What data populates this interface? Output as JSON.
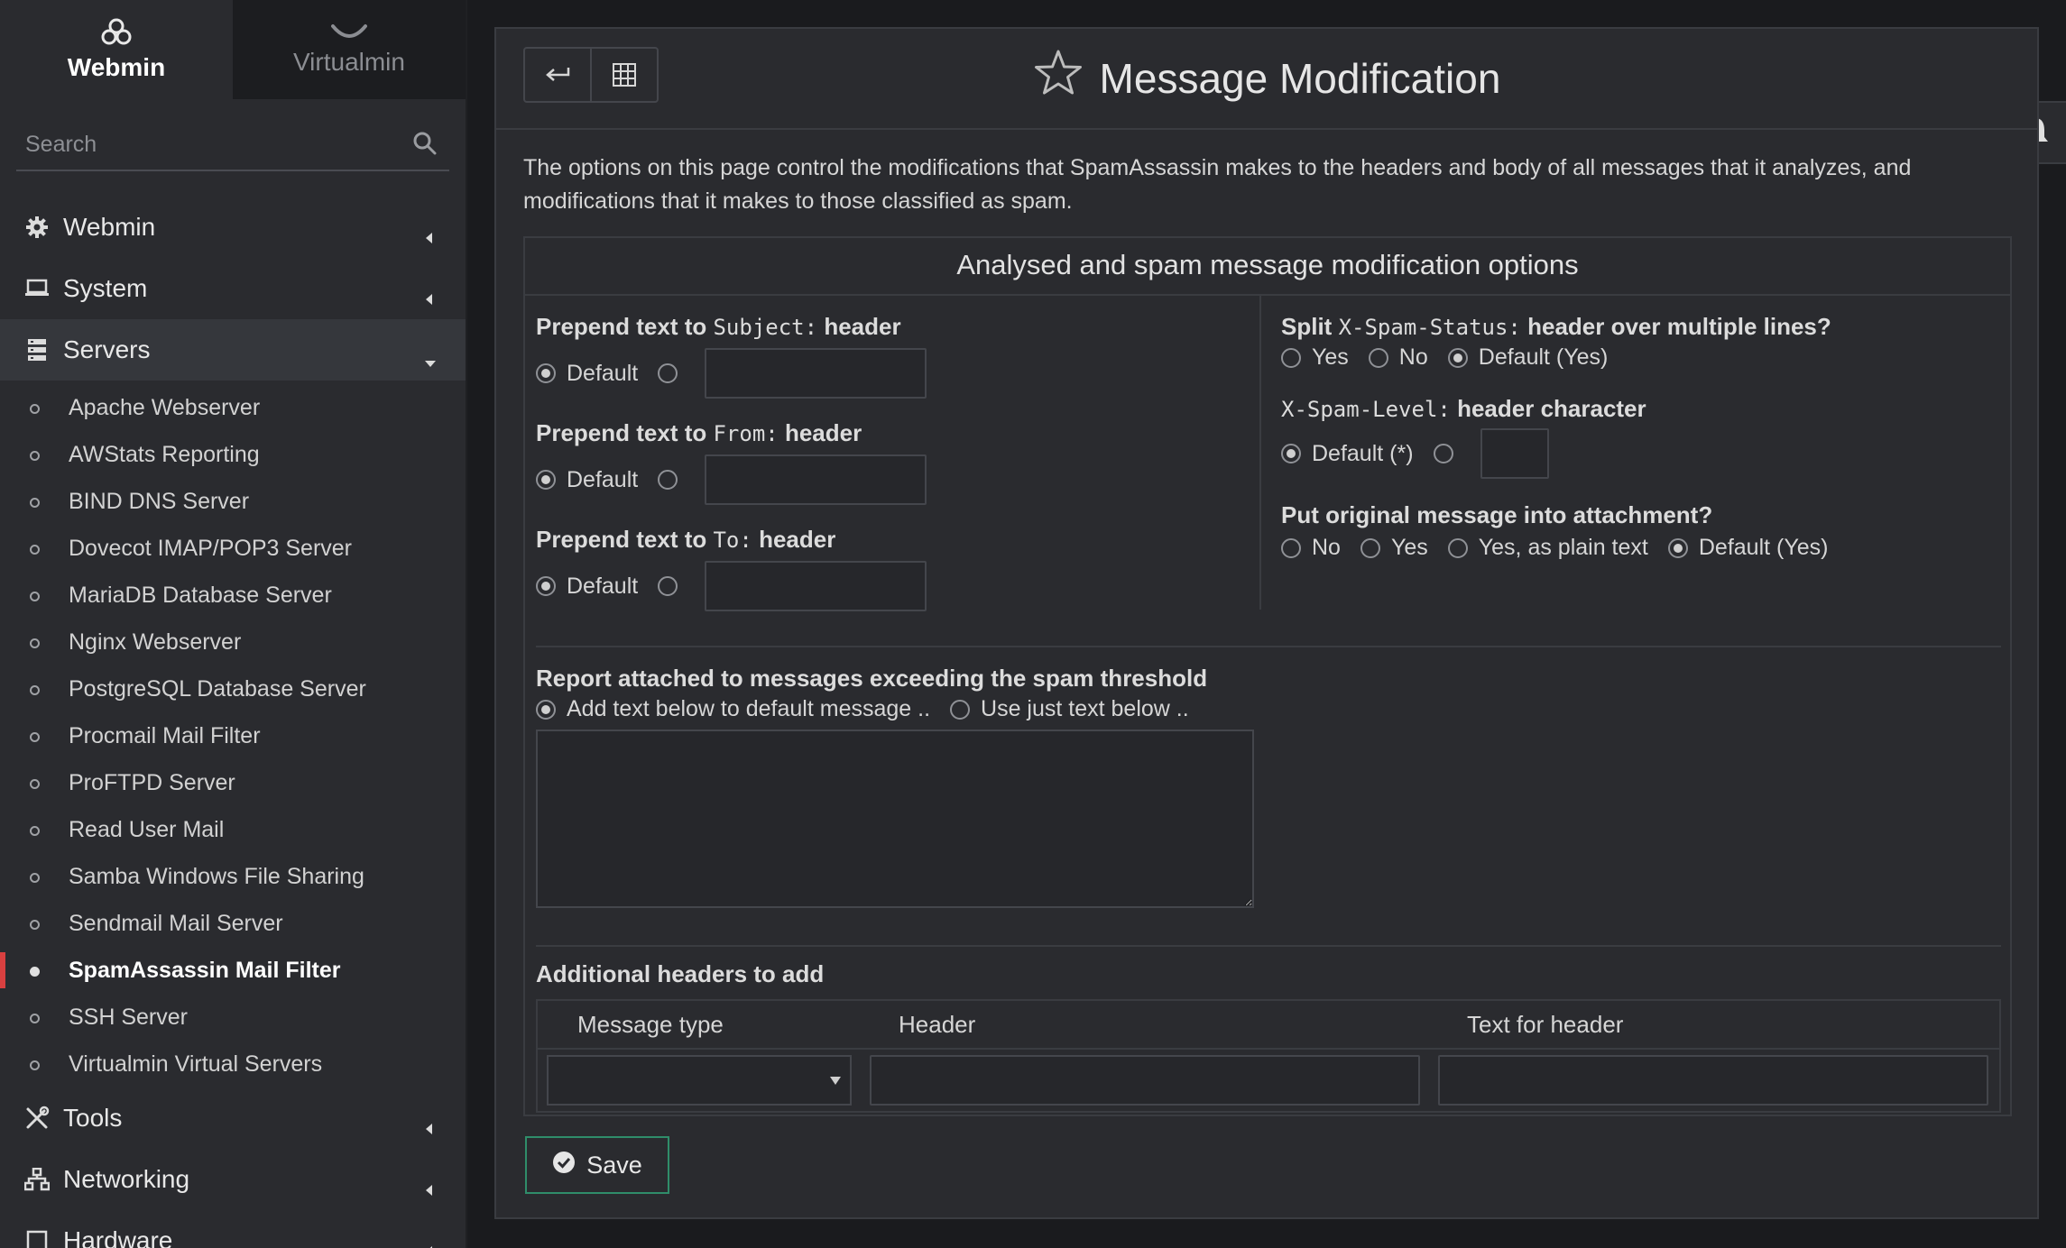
{
  "switcher": {
    "webmin_label": "Webmin",
    "virtualmin_label": "Virtualmin"
  },
  "search": {
    "placeholder": "Search"
  },
  "menu": {
    "categories": [
      {
        "label": "Webmin",
        "icon": "gear-icon"
      },
      {
        "label": "System",
        "icon": "laptop-icon"
      },
      {
        "label": "Servers",
        "icon": "server-icon"
      },
      {
        "label": "Tools",
        "icon": "tools-icon"
      },
      {
        "label": "Networking",
        "icon": "network-icon"
      },
      {
        "label": "Hardware",
        "icon": "hardware-icon"
      }
    ],
    "servers_items": [
      "Apache Webserver",
      "AWStats Reporting",
      "BIND DNS Server",
      "Dovecot IMAP/POP3 Server",
      "MariaDB Database Server",
      "Nginx Webserver",
      "PostgreSQL Database Server",
      "Procmail Mail Filter",
      "ProFTPD Server",
      "Read User Mail",
      "Samba Windows File Sharing",
      "Sendmail Mail Server",
      "SpamAssassin Mail Filter",
      "SSH Server",
      "Virtualmin Virtual Servers"
    ],
    "active_item": "SpamAssassin Mail Filter"
  },
  "page": {
    "title": "Message Modification",
    "description": "The options on this page control the modifications that SpamAssassin makes to the headers and body of all messages that it analyzes, and modifications that it makes to those classified as spam.",
    "section_title": "Analysed and spam message modification options"
  },
  "form": {
    "subject": {
      "pre": "Prepend text to",
      "code": "Subject:",
      "post": "header",
      "default_label": "Default",
      "value": ""
    },
    "from": {
      "pre": "Prepend text to",
      "code": "From:",
      "post": "header",
      "default_label": "Default",
      "value": ""
    },
    "to": {
      "pre": "Prepend text to",
      "code": "To:",
      "post": "header",
      "default_label": "Default",
      "value": ""
    },
    "split": {
      "pre": "Split",
      "code": "X-Spam-Status:",
      "post": "header over multiple lines?",
      "options": [
        "Yes",
        "No",
        "Default (Yes)"
      ],
      "selected": "Default (Yes)"
    },
    "level": {
      "code": "X-Spam-Level:",
      "post": "header character",
      "default_label": "Default (*)",
      "value": ""
    },
    "attach": {
      "label": "Put original message into attachment?",
      "options": [
        "No",
        "Yes",
        "Yes, as plain text",
        "Default (Yes)"
      ],
      "selected": "Default (Yes)"
    },
    "report": {
      "label": "Report attached to messages exceeding the spam threshold",
      "options": [
        "Add text below to default message ..",
        "Use just text below .."
      ],
      "selected": "Add text below to default message ..",
      "text": ""
    },
    "headers": {
      "label": "Additional headers to add",
      "columns": [
        "Message type",
        "Header",
        "Text for header"
      ],
      "row": {
        "type": "",
        "header": "",
        "text": ""
      }
    }
  },
  "save_label": "Save"
}
